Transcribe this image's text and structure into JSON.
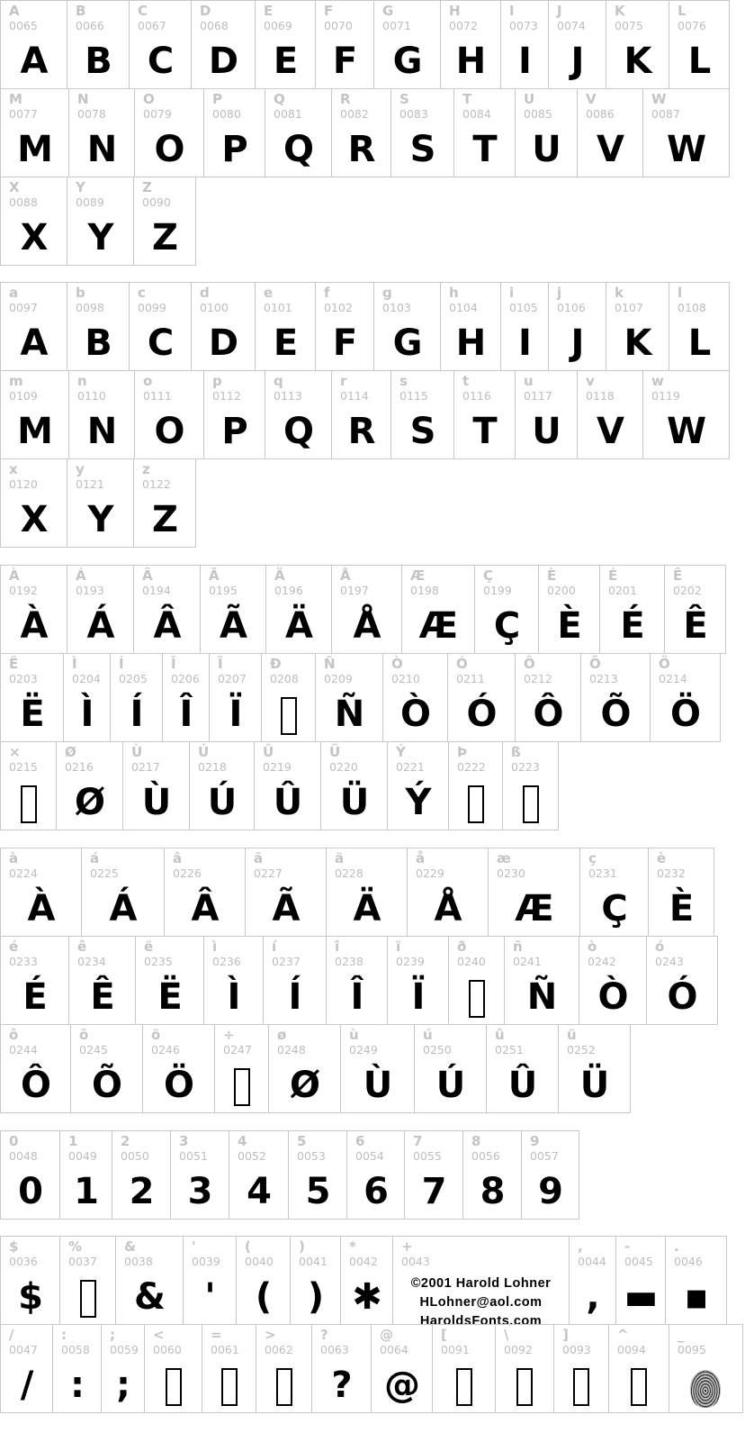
{
  "sections": [
    {
      "rows": [
        [
          [
            "A",
            "0065"
          ],
          [
            "B",
            "0066"
          ],
          [
            "C",
            "0067"
          ],
          [
            "D",
            "0068"
          ],
          [
            "E",
            "0069"
          ],
          [
            "F",
            "0070"
          ],
          [
            "G",
            "0071"
          ],
          [
            "H",
            "0072"
          ],
          [
            "I",
            "0073"
          ],
          [
            "J",
            "0074"
          ],
          [
            "K",
            "0075"
          ],
          [
            "L",
            "0076"
          ]
        ],
        [
          [
            "M",
            "0077"
          ],
          [
            "N",
            "0078"
          ],
          [
            "O",
            "0079"
          ],
          [
            "P",
            "0080"
          ],
          [
            "Q",
            "0081"
          ],
          [
            "R",
            "0082"
          ],
          [
            "S",
            "0083"
          ],
          [
            "T",
            "0084"
          ],
          [
            "U",
            "0085"
          ],
          [
            "V",
            "0086"
          ],
          [
            "W",
            "0087"
          ]
        ],
        [
          [
            "X",
            "0088"
          ],
          [
            "Y",
            "0089"
          ],
          [
            "Z",
            "0090"
          ]
        ]
      ]
    },
    {
      "rows": [
        [
          [
            "a",
            "0097",
            "A"
          ],
          [
            "b",
            "0098",
            "B"
          ],
          [
            "c",
            "0099",
            "C"
          ],
          [
            "d",
            "0100",
            "D"
          ],
          [
            "e",
            "0101",
            "E"
          ],
          [
            "f",
            "0102",
            "F"
          ],
          [
            "g",
            "0103",
            "G"
          ],
          [
            "h",
            "0104",
            "H"
          ],
          [
            "i",
            "0105",
            "I"
          ],
          [
            "j",
            "0106",
            "J"
          ],
          [
            "k",
            "0107",
            "K"
          ],
          [
            "l",
            "0108",
            "L"
          ]
        ],
        [
          [
            "m",
            "0109",
            "M"
          ],
          [
            "n",
            "0110",
            "N"
          ],
          [
            "o",
            "0111",
            "O"
          ],
          [
            "p",
            "0112",
            "P"
          ],
          [
            "q",
            "0113",
            "Q"
          ],
          [
            "r",
            "0114",
            "R"
          ],
          [
            "s",
            "0115",
            "S"
          ],
          [
            "t",
            "0116",
            "T"
          ],
          [
            "u",
            "0117",
            "U"
          ],
          [
            "v",
            "0118",
            "V"
          ],
          [
            "w",
            "0119",
            "W"
          ]
        ],
        [
          [
            "x",
            "0120",
            "X"
          ],
          [
            "y",
            "0121",
            "Y"
          ],
          [
            "z",
            "0122",
            "Z"
          ]
        ]
      ]
    },
    {
      "rows": [
        [
          [
            "À",
            "0192"
          ],
          [
            "Á",
            "0193"
          ],
          [
            "Â",
            "0194"
          ],
          [
            "Ã",
            "0195"
          ],
          [
            "Ä",
            "0196"
          ],
          [
            "Å",
            "0197"
          ],
          [
            "Æ",
            "0198"
          ],
          [
            "Ç",
            "0199"
          ],
          [
            "È",
            "0200"
          ],
          [
            "É",
            "0201"
          ],
          [
            "Ê",
            "0202"
          ]
        ],
        [
          [
            "Ë",
            "0203"
          ],
          [
            "Ì",
            "0204"
          ],
          [
            "Í",
            "0205"
          ],
          [
            "Î",
            "0206"
          ],
          [
            "Ï",
            "0207"
          ],
          [
            "Ð",
            "0208",
            null
          ],
          [
            "Ñ",
            "0209"
          ],
          [
            "Ò",
            "0210"
          ],
          [
            "Ó",
            "0211"
          ],
          [
            "Ô",
            "0212"
          ],
          [
            "Õ",
            "0213"
          ],
          [
            "Ö",
            "0214"
          ]
        ],
        [
          [
            "×",
            "0215",
            null
          ],
          [
            "Ø",
            "0216"
          ],
          [
            "Ù",
            "0217"
          ],
          [
            "Ú",
            "0218"
          ],
          [
            "Û",
            "0219"
          ],
          [
            "Ü",
            "0220"
          ],
          [
            "Ý",
            "0221"
          ],
          [
            "Þ",
            "0222",
            null
          ],
          [
            "ß",
            "0223",
            null
          ]
        ]
      ]
    },
    {
      "rows": [
        [
          [
            "à",
            "0224",
            "À"
          ],
          [
            "á",
            "0225",
            "Á"
          ],
          [
            "â",
            "0226",
            "Â"
          ],
          [
            "ã",
            "0227",
            "Ã"
          ],
          [
            "ä",
            "0228",
            "Ä"
          ],
          [
            "å",
            "0229",
            "Å"
          ],
          [
            "æ",
            "0230",
            "Æ"
          ],
          [
            "ç",
            "0231",
            "Ç"
          ],
          [
            "è",
            "0232",
            "È"
          ]
        ],
        [
          [
            "é",
            "0233",
            "É"
          ],
          [
            "ê",
            "0234",
            "Ê"
          ],
          [
            "ë",
            "0235",
            "Ë"
          ],
          [
            "ì",
            "0236",
            "Ì"
          ],
          [
            "í",
            "0237",
            "Í"
          ],
          [
            "î",
            "0238",
            "Î"
          ],
          [
            "ï",
            "0239",
            "Ï"
          ],
          [
            "ð",
            "0240",
            null
          ],
          [
            "ñ",
            "0241",
            "Ñ"
          ],
          [
            "ò",
            "0242",
            "Ò"
          ],
          [
            "ó",
            "0243",
            "Ó"
          ]
        ],
        [
          [
            "ô",
            "0244",
            "Ô"
          ],
          [
            "õ",
            "0245",
            "Õ"
          ],
          [
            "ö",
            "0246",
            "Ö"
          ],
          [
            "÷",
            "0247",
            null
          ],
          [
            "ø",
            "0248",
            "Ø"
          ],
          [
            "ù",
            "0249",
            "Ù"
          ],
          [
            "ú",
            "0250",
            "Ú"
          ],
          [
            "û",
            "0251",
            "Û"
          ],
          [
            "ü",
            "0252",
            "Ü"
          ]
        ]
      ]
    },
    {
      "rows": [
        [
          [
            "0",
            "0048"
          ],
          [
            "1",
            "0049"
          ],
          [
            "2",
            "0050"
          ],
          [
            "3",
            "0051"
          ],
          [
            "4",
            "0052"
          ],
          [
            "5",
            "0053"
          ],
          [
            "6",
            "0054"
          ],
          [
            "7",
            "0055"
          ],
          [
            "8",
            "0056"
          ],
          [
            "9",
            "0057"
          ]
        ]
      ]
    },
    {
      "rows": [
        [
          [
            "$",
            "0036"
          ],
          [
            "%",
            "0037",
            null
          ],
          [
            "&",
            "0038"
          ],
          [
            "'",
            "0039"
          ],
          [
            "(",
            "0040"
          ],
          [
            ")",
            "0041"
          ],
          [
            "*",
            "0042",
            "✱"
          ],
          [
            "+",
            "0043",
            "credit"
          ],
          [
            ",",
            "0044"
          ],
          [
            "-",
            "0045",
            "▬"
          ],
          [
            ".",
            "0046",
            "▪"
          ]
        ],
        [
          [
            "/",
            "0047"
          ],
          [
            ":",
            "0058"
          ],
          [
            ";",
            "0059"
          ],
          [
            "<",
            "0060",
            null
          ],
          [
            "=",
            "0061",
            null
          ],
          [
            ">",
            "0062",
            null
          ],
          [
            "?",
            "0063"
          ],
          [
            "@",
            "0064"
          ],
          [
            "[",
            "0091",
            null
          ],
          [
            "\\",
            "0092",
            null
          ],
          [
            "]",
            "0093",
            null
          ],
          [
            "^",
            "0094",
            null
          ],
          [
            "_",
            "0095",
            "fingerprint"
          ]
        ]
      ]
    }
  ],
  "credit": {
    "line1": "©2001 Harold Lohner",
    "line2": "HLohner@aol.com",
    "line3": "HaroldsFonts.com"
  },
  "colors": {
    "border": "#c8c8c8",
    "label": "#bdbdbd",
    "glyph": "#000000"
  }
}
